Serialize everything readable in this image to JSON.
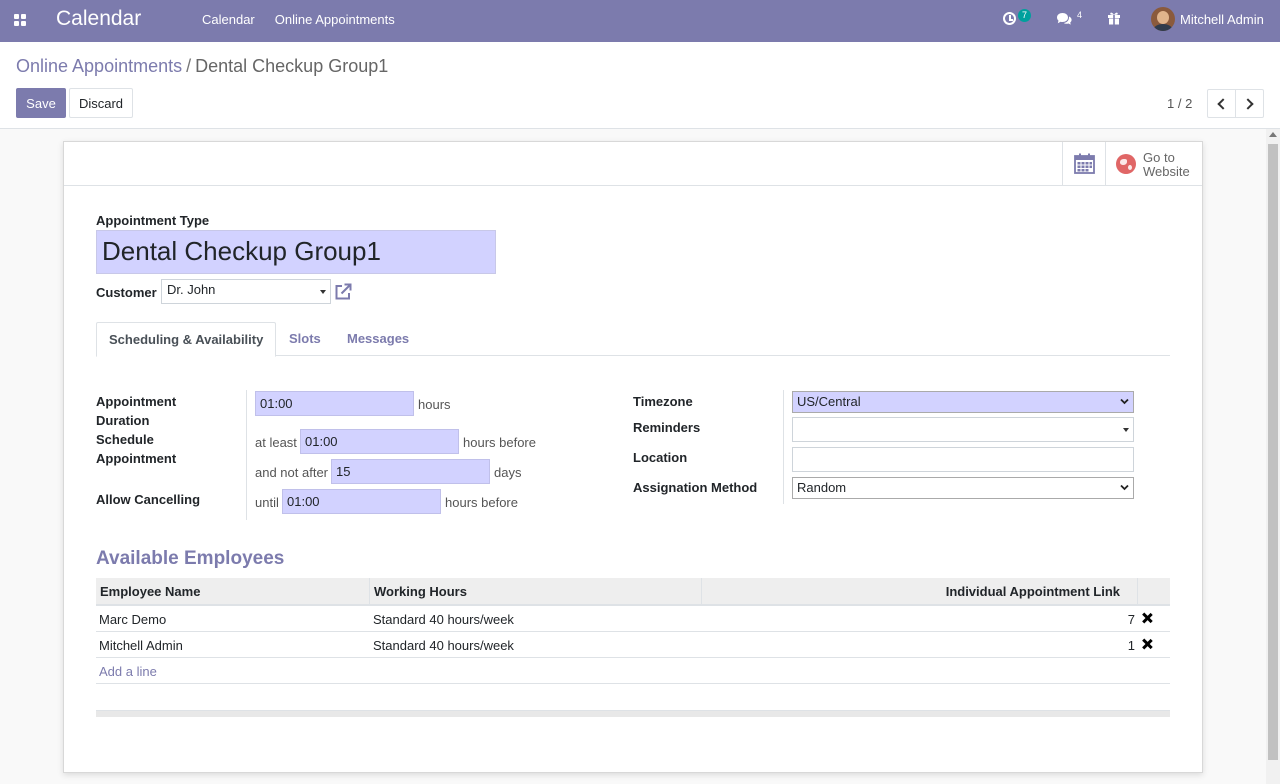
{
  "app": {
    "title": "Calendar",
    "menu": [
      "Calendar",
      "Online Appointments"
    ],
    "systray": {
      "activity_count": "7",
      "message_count": "4",
      "user_name": "Mitchell Admin"
    }
  },
  "breadcrumb": {
    "parent": "Online Appointments",
    "separator": "/",
    "current": "Dental Checkup Group1"
  },
  "buttons": {
    "save": "Save",
    "discard": "Discard"
  },
  "pager": {
    "value": "1 / 2"
  },
  "button_box": {
    "website_line1": "Go to",
    "website_line2": "Website"
  },
  "form": {
    "appointment_type_label": "Appointment Type",
    "name": "Dental Checkup Group1",
    "customer_label": "Customer",
    "customer_value": "Dr. John"
  },
  "tabs": [
    "Scheduling & Availability",
    "Slots",
    "Messages"
  ],
  "scheduling": {
    "duration_label_1": "Appointment",
    "duration_label_2": "Duration",
    "duration_value": "01:00",
    "duration_unit": "hours",
    "schedule_label_1": "Schedule",
    "schedule_label_2": "Appointment",
    "at_least_text": "at least",
    "min_schedule_value": "01:00",
    "min_schedule_unit": "hours before",
    "not_after_text": "and not after",
    "max_schedule_value": "15",
    "max_schedule_unit": "days",
    "cancel_label": "Allow Cancelling",
    "until_text": "until",
    "cancel_value": "01:00",
    "cancel_unit": "hours before",
    "timezone_label": "Timezone",
    "timezone_value": "US/Central",
    "reminders_label": "Reminders",
    "reminders_value": "",
    "location_label": "Location",
    "location_value": "",
    "assignation_label": "Assignation Method",
    "assignation_value": "Random"
  },
  "employees": {
    "section_title": "Available Employees",
    "columns": [
      "Employee Name",
      "Working Hours",
      "Individual Appointment Link"
    ],
    "rows": [
      {
        "name": "Marc Demo",
        "hours": "Standard 40 hours/week",
        "link": "7"
      },
      {
        "name": "Mitchell Admin",
        "hours": "Standard 40 hours/week",
        "link": "1"
      }
    ],
    "add_line": "Add a line"
  },
  "colors": {
    "brand": "#7c7bad",
    "input_bg": "#d2d2ff",
    "badge": "#00a09d"
  }
}
